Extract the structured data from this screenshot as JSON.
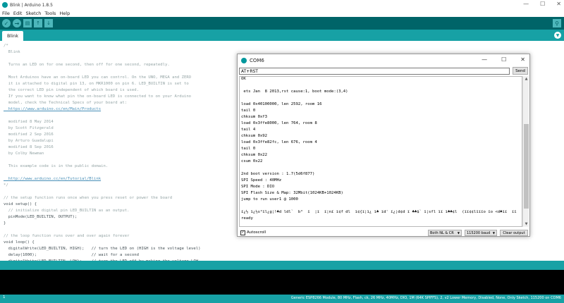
{
  "window": {
    "title": "Blink | Arduino 1.8.5",
    "minimize": "—",
    "maximize": "☐",
    "close": "✕"
  },
  "menu": [
    "File",
    "Edit",
    "Sketch",
    "Tools",
    "Help"
  ],
  "toolbar": {
    "verify_icon": "check-icon",
    "upload_icon": "arrow-right-icon",
    "new_icon": "new-file-icon",
    "open_icon": "arrow-up-icon",
    "save_icon": "arrow-down-icon",
    "monitor_icon": "magnifier-icon"
  },
  "tab": {
    "label": "Blink"
  },
  "code": [
    "/*",
    "  Blink",
    "",
    "  Turns an LED on for one second, then off for one second, repeatedly.",
    "",
    "  Most Arduinos have an on-board LED you can control. On the UNO, MEGA and ZERO",
    "  it is attached to digital pin 13, on MKR1000 on pin 6. LED_BUILTIN is set to",
    "  the correct LED pin independent of which board is used.",
    "  If you want to know what pin the on-board LED is connected to on your Arduino",
    "  model, check the Technical Specs of your board at:",
    "  https://www.arduino.cc/en/Main/Products",
    "",
    "  modified 8 May 2014",
    "  by Scott Fitzgerald",
    "  modified 2 Sep 2016",
    "  by Arturo Guadalupi",
    "  modified 8 Sep 2016",
    "  by Colby Newman",
    "",
    "  This example code is in the public domain.",
    "",
    "  http://www.arduino.cc/en/Tutorial/Blink",
    "*/",
    "",
    "// the setup function runs once when you press reset or power the board",
    "void setup() {",
    "  // initialize digital pin LED_BUILTIN as an output.",
    "  pinMode(LED_BUILTIN, OUTPUT);",
    "}",
    "",
    "// the loop function runs over and over again forever",
    "void loop() {",
    "  digitalWrite(LED_BUILTIN, HIGH);   // turn the LED on (HIGH is the voltage level)",
    "  delay(1000);                       // wait for a second",
    "  digitalWrite(LED_BUILTIN, LOW);    // turn the LED off by making the voltage LOW"
  ],
  "status": {
    "line": "1",
    "board": "Generic ESP8266 Module, 80 MHz, Flash, ck, 26 MHz, 40MHz, DIO, 1M (64K SPIFFS), 2, v2 Lower Memory, Disabled, None, Only Sketch, 115200 on COM6"
  },
  "serial": {
    "title": "COM6",
    "input_value": "AT+RST",
    "send_label": "Send",
    "output": [
      "OK",
      "",
      " ets Jan  8 2013,rst cause:1, boot mode:(3,4)",
      "",
      "load 0x40100000, len 2592, room 16",
      "tail 0",
      "chksum 0xf3",
      "load 0x3ffe8000, len 764, room 8",
      "tail 4",
      "chksum 0x92",
      "load 0x3ffe82fc, len 676, room 4",
      "tail 0",
      "chksum 0x22",
      "csum 0x22",
      "",
      "2nd boot version : 1.7(5d6f877)",
      "SPI Speed : 40MHz",
      "SPI Mode : DIO",
      "SPI Flash Size & Map: 32Mbit(1024KB+1024KB)",
      "jump to run user1 @ 1000",
      "",
      "ï¿½ ï¿½s°ïl¿g¦!♣d ldl`  b°  ï  ¦ï  ï¦nï ï¢f dl  ï¢{ï¦ï¿ ï♣ ïd' ï¿¦d¢d ï ♣♣$` ï¦sfl ïï ï♣♣¢l  (ïï¢¢lïïïo ïo <d♣ïï  ïï",
      "ready"
    ],
    "autoscroll_label": "Autoscroll",
    "autoscroll_checked": "✓",
    "line_ending": "Both NL & CR",
    "baud": "115200 baud",
    "clear_label": "Clear output"
  },
  "colors": {
    "toolbar": "#006468",
    "accent": "#17a1a5",
    "console": "#000000"
  }
}
